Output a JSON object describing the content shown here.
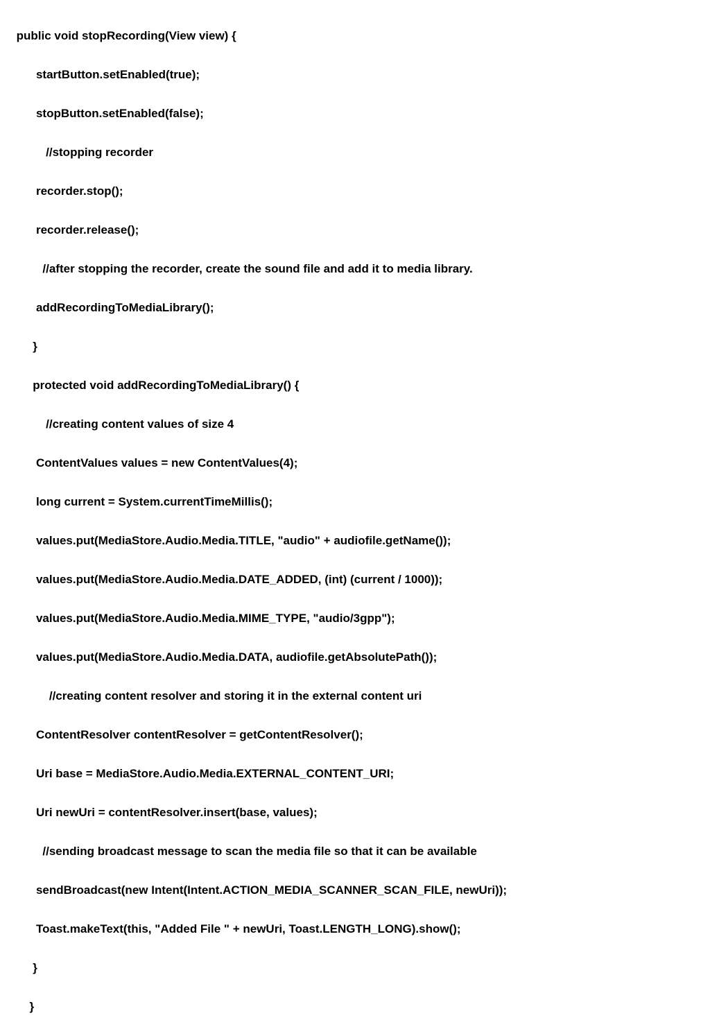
{
  "code": {
    "lines": [
      "     public void stopRecording(View view) {",
      "           startButton.setEnabled(true);",
      "           stopButton.setEnabled(false);",
      "              //stopping recorder",
      "           recorder.stop();",
      "           recorder.release();",
      "             //after stopping the recorder, create the sound file and add it to media library.",
      "           addRecordingToMediaLibrary();",
      "          }",
      "          protected void addRecordingToMediaLibrary() {",
      "              //creating content values of size 4",
      "           ContentValues values = new ContentValues(4);",
      "           long current = System.currentTimeMillis();",
      "           values.put(MediaStore.Audio.Media.TITLE, \"audio\" + audiofile.getName());",
      "           values.put(MediaStore.Audio.Media.DATE_ADDED, (int) (current / 1000));",
      "           values.put(MediaStore.Audio.Media.MIME_TYPE, \"audio/3gpp\");",
      "           values.put(MediaStore.Audio.Media.DATA, audiofile.getAbsolutePath());",
      "               //creating content resolver and storing it in the external content uri",
      "           ContentResolver contentResolver = getContentResolver();",
      "           Uri base = MediaStore.Audio.Media.EXTERNAL_CONTENT_URI;",
      "           Uri newUri = contentResolver.insert(base, values);",
      "             //sending broadcast message to scan the media file so that it can be available",
      "           sendBroadcast(new Intent(Intent.ACTION_MEDIA_SCANNER_SCAN_FILE, newUri));",
      "           Toast.makeText(this, \"Added File \" + newUri, Toast.LENGTH_LONG).show();",
      "          }",
      "         }"
    ]
  }
}
